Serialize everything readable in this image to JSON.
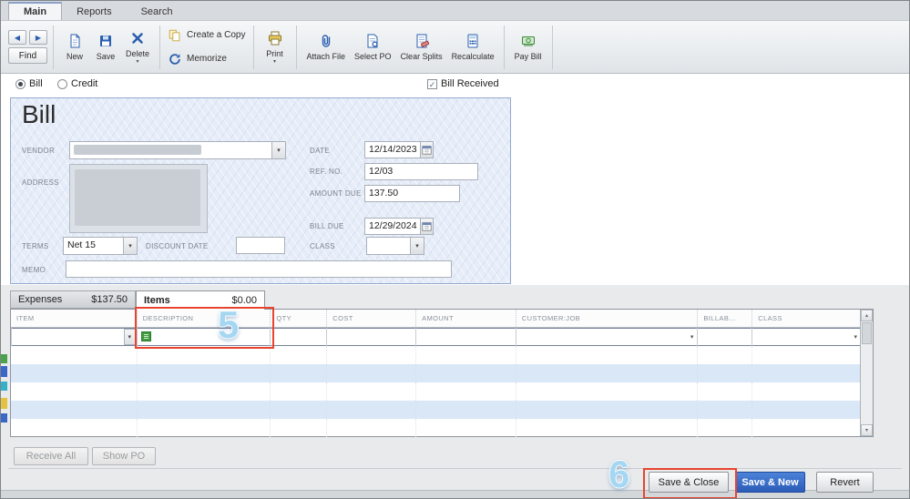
{
  "window": {
    "tabs": [
      "Main",
      "Reports",
      "Search"
    ]
  },
  "toolbar": {
    "find_label": "Find",
    "new_label": "New",
    "save_label": "Save",
    "delete_label": "Delete",
    "create_copy_label": "Create a Copy",
    "memorize_label": "Memorize",
    "print_label": "Print",
    "attach_file_label": "Attach File",
    "select_po_label": "Select PO",
    "clear_splits_label": "Clear Splits",
    "recalculate_label": "Recalculate",
    "pay_bill_label": "Pay Bill"
  },
  "header_controls": {
    "bill_radio_label": "Bill",
    "credit_radio_label": "Credit",
    "bill_received_label": "Bill Received",
    "bill_radio_selected": true,
    "bill_received_checked": true
  },
  "bill_form": {
    "title": "Bill",
    "vendor_label": "VENDOR",
    "address_label": "ADDRESS",
    "terms_label": "TERMS",
    "terms_value": "Net 15",
    "discount_date_label": "DISCOUNT DATE",
    "memo_label": "MEMO",
    "date_label": "DATE",
    "date_value": "12/14/2023",
    "ref_no_label": "REF. NO.",
    "ref_no_value": "12/03",
    "amount_due_label": "AMOUNT DUE",
    "amount_due_value": "137.50",
    "bill_due_label": "BILL DUE",
    "bill_due_value": "12/29/2024",
    "class_label": "CLASS"
  },
  "detail_tabs": {
    "expenses_label": "Expenses",
    "expenses_amount": "$137.50",
    "items_label": "Items",
    "items_amount": "$0.00"
  },
  "items_table": {
    "columns": [
      "ITEM",
      "DESCRIPTION",
      "QTY",
      "COST",
      "AMOUNT",
      "CUSTOMER:JOB",
      "BILLAB...",
      "CLASS"
    ]
  },
  "footer": {
    "receive_all_label": "Receive All",
    "show_po_label": "Show PO",
    "save_close_label": "Save & Close",
    "save_new_label": "Save & New",
    "revert_label": "Revert"
  },
  "annotations": {
    "step_5": "5",
    "step_6": "6"
  },
  "colors": {
    "accent_blue": "#2b5fae",
    "annotation_red": "#e8442f",
    "annotation_blue": "#a6d7f2",
    "row_highlight": "#d9e7f7"
  }
}
